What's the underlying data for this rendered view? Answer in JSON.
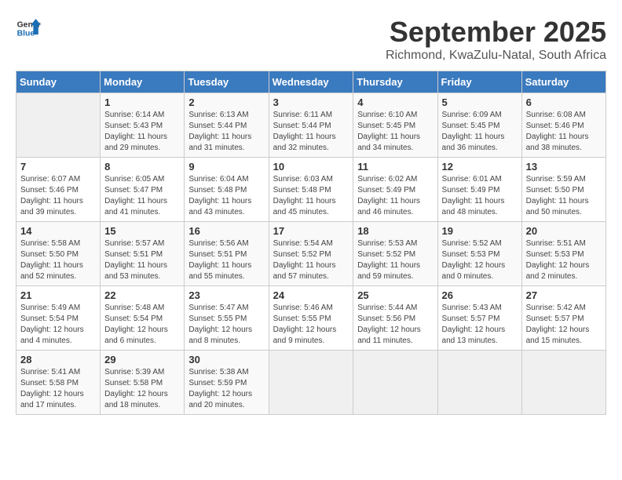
{
  "logo": {
    "line1": "General",
    "line2": "Blue"
  },
  "title": "September 2025",
  "location": "Richmond, KwaZulu-Natal, South Africa",
  "days_of_week": [
    "Sunday",
    "Monday",
    "Tuesday",
    "Wednesday",
    "Thursday",
    "Friday",
    "Saturday"
  ],
  "weeks": [
    [
      {
        "day": "",
        "empty": true
      },
      {
        "day": "1",
        "sunrise": "6:14 AM",
        "sunset": "5:43 PM",
        "daylight": "11 hours and 29 minutes."
      },
      {
        "day": "2",
        "sunrise": "6:13 AM",
        "sunset": "5:44 PM",
        "daylight": "11 hours and 31 minutes."
      },
      {
        "day": "3",
        "sunrise": "6:11 AM",
        "sunset": "5:44 PM",
        "daylight": "11 hours and 32 minutes."
      },
      {
        "day": "4",
        "sunrise": "6:10 AM",
        "sunset": "5:45 PM",
        "daylight": "11 hours and 34 minutes."
      },
      {
        "day": "5",
        "sunrise": "6:09 AM",
        "sunset": "5:45 PM",
        "daylight": "11 hours and 36 minutes."
      },
      {
        "day": "6",
        "sunrise": "6:08 AM",
        "sunset": "5:46 PM",
        "daylight": "11 hours and 38 minutes."
      }
    ],
    [
      {
        "day": "7",
        "sunrise": "6:07 AM",
        "sunset": "5:46 PM",
        "daylight": "11 hours and 39 minutes."
      },
      {
        "day": "8",
        "sunrise": "6:05 AM",
        "sunset": "5:47 PM",
        "daylight": "11 hours and 41 minutes."
      },
      {
        "day": "9",
        "sunrise": "6:04 AM",
        "sunset": "5:48 PM",
        "daylight": "11 hours and 43 minutes."
      },
      {
        "day": "10",
        "sunrise": "6:03 AM",
        "sunset": "5:48 PM",
        "daylight": "11 hours and 45 minutes."
      },
      {
        "day": "11",
        "sunrise": "6:02 AM",
        "sunset": "5:49 PM",
        "daylight": "11 hours and 46 minutes."
      },
      {
        "day": "12",
        "sunrise": "6:01 AM",
        "sunset": "5:49 PM",
        "daylight": "11 hours and 48 minutes."
      },
      {
        "day": "13",
        "sunrise": "5:59 AM",
        "sunset": "5:50 PM",
        "daylight": "11 hours and 50 minutes."
      }
    ],
    [
      {
        "day": "14",
        "sunrise": "5:58 AM",
        "sunset": "5:50 PM",
        "daylight": "11 hours and 52 minutes."
      },
      {
        "day": "15",
        "sunrise": "5:57 AM",
        "sunset": "5:51 PM",
        "daylight": "11 hours and 53 minutes."
      },
      {
        "day": "16",
        "sunrise": "5:56 AM",
        "sunset": "5:51 PM",
        "daylight": "11 hours and 55 minutes."
      },
      {
        "day": "17",
        "sunrise": "5:54 AM",
        "sunset": "5:52 PM",
        "daylight": "11 hours and 57 minutes."
      },
      {
        "day": "18",
        "sunrise": "5:53 AM",
        "sunset": "5:52 PM",
        "daylight": "11 hours and 59 minutes."
      },
      {
        "day": "19",
        "sunrise": "5:52 AM",
        "sunset": "5:53 PM",
        "daylight": "12 hours and 0 minutes."
      },
      {
        "day": "20",
        "sunrise": "5:51 AM",
        "sunset": "5:53 PM",
        "daylight": "12 hours and 2 minutes."
      }
    ],
    [
      {
        "day": "21",
        "sunrise": "5:49 AM",
        "sunset": "5:54 PM",
        "daylight": "12 hours and 4 minutes."
      },
      {
        "day": "22",
        "sunrise": "5:48 AM",
        "sunset": "5:54 PM",
        "daylight": "12 hours and 6 minutes."
      },
      {
        "day": "23",
        "sunrise": "5:47 AM",
        "sunset": "5:55 PM",
        "daylight": "12 hours and 8 minutes."
      },
      {
        "day": "24",
        "sunrise": "5:46 AM",
        "sunset": "5:55 PM",
        "daylight": "12 hours and 9 minutes."
      },
      {
        "day": "25",
        "sunrise": "5:44 AM",
        "sunset": "5:56 PM",
        "daylight": "12 hours and 11 minutes."
      },
      {
        "day": "26",
        "sunrise": "5:43 AM",
        "sunset": "5:57 PM",
        "daylight": "12 hours and 13 minutes."
      },
      {
        "day": "27",
        "sunrise": "5:42 AM",
        "sunset": "5:57 PM",
        "daylight": "12 hours and 15 minutes."
      }
    ],
    [
      {
        "day": "28",
        "sunrise": "5:41 AM",
        "sunset": "5:58 PM",
        "daylight": "12 hours and 17 minutes."
      },
      {
        "day": "29",
        "sunrise": "5:39 AM",
        "sunset": "5:58 PM",
        "daylight": "12 hours and 18 minutes."
      },
      {
        "day": "30",
        "sunrise": "5:38 AM",
        "sunset": "5:59 PM",
        "daylight": "12 hours and 20 minutes."
      },
      {
        "day": "",
        "empty": true
      },
      {
        "day": "",
        "empty": true
      },
      {
        "day": "",
        "empty": true
      },
      {
        "day": "",
        "empty": true
      }
    ]
  ],
  "labels": {
    "sunrise_prefix": "Sunrise: ",
    "sunset_prefix": "Sunset: ",
    "daylight_prefix": "Daylight: "
  }
}
